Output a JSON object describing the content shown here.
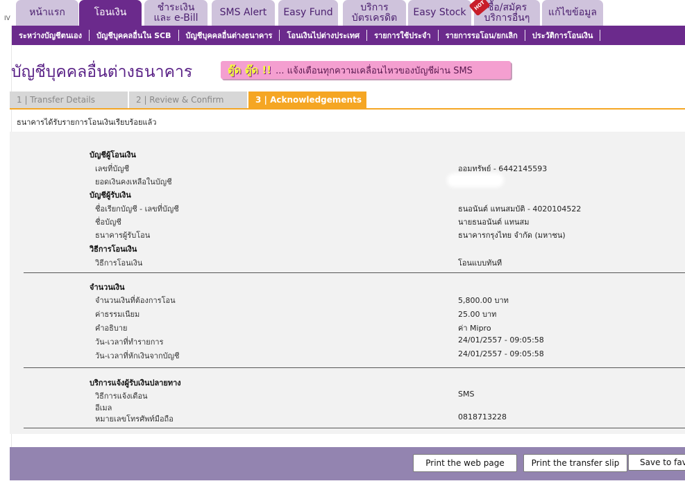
{
  "corner_mark": "IV",
  "tabs": [
    {
      "label": "หน้าแรก",
      "active": false
    },
    {
      "label": "โอนเงิน",
      "active": true
    },
    {
      "label": "ชำระเงิน\nและ e-Bill",
      "active": false
    },
    {
      "label": "SMS Alert",
      "active": false
    },
    {
      "label": "Easy Fund",
      "active": false
    },
    {
      "label": "บริการ\nบัตรเครดิต",
      "active": false
    },
    {
      "label": "Easy Stock",
      "active": false
    },
    {
      "label": "ซื้อ/สมัคร\nบริการอื่นๆ",
      "active": false,
      "badge": "HOT"
    },
    {
      "label": "แก้ไขข้อมูล",
      "active": false
    }
  ],
  "subnav": [
    "ระหว่างบัญชีตนเอง",
    "บัญชีบุคคลอื่นใน SCB",
    "บัญชีบุคคลอื่นต่างธนาคาร",
    "โอนเงินไปต่างประเทศ",
    "รายการใช้ประจำ",
    "รายการรอโอน/ยกเลิก",
    "ประวัติการโอนเงิน"
  ],
  "page_title": "บัญชีบุคคลอื่นต่างธนาคาร",
  "banner": {
    "highlight": "ตู๊ด ตู๊ด !!",
    "text": "... แจ้งเตือนทุกความเคลื่อนไหวของบัญชีผ่าน SMS"
  },
  "steps": [
    "1 | Transfer Details",
    "2 | Review & Confirm",
    "3 | Acknowledgements"
  ],
  "notice": "ธนาคารได้รับรายการโอนเงินเรียบร้อยแล้ว",
  "details": {
    "from_section": "บัญชีผู้โอนเงิน",
    "account_no_label": "เลขที่บัญชี",
    "account_no_value": "ออมทรัพย์ - 6442145593",
    "balance_label": "ยอดเงินคงเหลือในบัญชี",
    "to_section": "บัญชีผู้รับเงิน",
    "nickname_label": "ชื่อเรียกบัญชี - เลขที่บัญชี",
    "nickname_value": "ธนอนันต์ แทนสมบัติ - 4020104522",
    "account_name_label": "ชื่อบัญชี",
    "account_name_value": "นายธนอนันต์ แทนสม",
    "bank_label": "ธนาคารผู้รับโอน",
    "bank_value": "ธนาคารกรุงไทย จำกัด (มหาชน)",
    "method_section": "วิธีการโอนเงิน",
    "method_label": "วิธีการโอนเงิน",
    "method_value": "โอนแบบทันที",
    "amount_section": "จำนวนเงิน",
    "amount_label": "จำนวนเงินที่ต้องการโอน",
    "amount_value": "5,800.00 บาท",
    "fee_label": "ค่าธรรมเนียม",
    "fee_value": "25.00  บาท",
    "desc_label": "คำอธิบาย",
    "desc_value": "ค่า Mipro",
    "txn_time_label": "วัน-เวลาที่ทำรายการ",
    "txn_time_value": "24/01/2557 - 09:05:58",
    "debit_time_label": "วัน-เวลาที่หักเงินจากบัญชี",
    "debit_time_value": "24/01/2557 - 09:05:58",
    "notify_section": "บริการแจ้งผู้รับเงินปลายทาง",
    "notify_method_label": "วิธีการแจ้งเตือน",
    "notify_method_value": "SMS",
    "email_label": "อีเมล",
    "phone_label": "หมายเลขโทรศัพท์มือถือ",
    "phone_value": "0818713228"
  },
  "buttons": {
    "print_page": "Print the web page",
    "print_slip": "Print the transfer slip",
    "save": "Save to favorite"
  }
}
